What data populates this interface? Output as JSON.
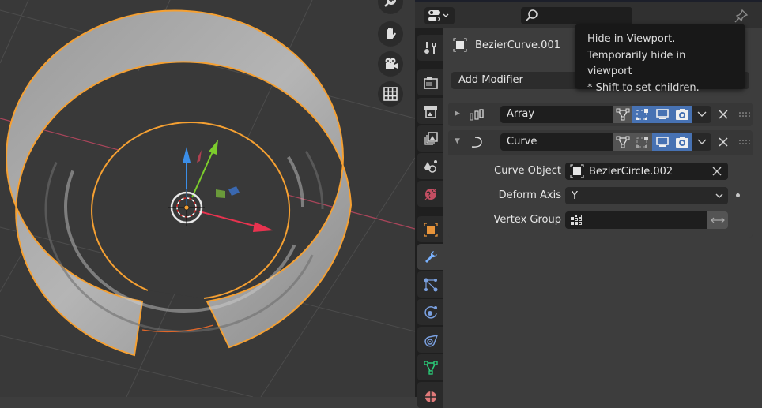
{
  "viewport": {
    "nav_buttons": [
      {
        "name": "zoom-icon"
      },
      {
        "name": "hand-pan-icon"
      },
      {
        "name": "camera-view-icon"
      },
      {
        "name": "grid-ortho-icon"
      }
    ],
    "colors": {
      "background": "#393939",
      "grid": "#4a4a4a",
      "x_axis": "#b8455a",
      "selection_outline": "#f5a032",
      "gizmo_x": "#e8334f",
      "gizmo_y": "#7ccd2c",
      "gizmo_z": "#3b8ee8"
    }
  },
  "properties": {
    "header": {
      "editor_type_icon": "properties-editor-icon",
      "search_placeholder": "",
      "pin_icon": "pin-icon"
    },
    "tabs": [
      {
        "name": "tool",
        "icon": "tool-icon"
      },
      {
        "name": "render",
        "icon": "render-icon"
      },
      {
        "name": "output",
        "icon": "output-icon"
      },
      {
        "name": "view-layer",
        "icon": "view-layer-icon"
      },
      {
        "name": "scene",
        "icon": "scene-icon"
      },
      {
        "name": "world",
        "icon": "world-icon"
      },
      {
        "name": "object",
        "icon": "object-icon"
      },
      {
        "name": "modifiers",
        "icon": "wrench-icon",
        "active": true
      },
      {
        "name": "particles",
        "icon": "particles-icon"
      },
      {
        "name": "physics",
        "icon": "physics-icon"
      },
      {
        "name": "constraints",
        "icon": "constraints-icon"
      },
      {
        "name": "data",
        "icon": "mesh-data-icon"
      },
      {
        "name": "material",
        "icon": "material-icon"
      }
    ],
    "object_name": "BezierCurve.001",
    "add_modifier_label": "Add Modifier",
    "modifiers": [
      {
        "name": "Array",
        "expanded": false,
        "edit_mode": false,
        "on_cage": true,
        "viewport": true,
        "render": true
      },
      {
        "name": "Curve",
        "expanded": true,
        "edit_mode": false,
        "on_cage": false,
        "viewport": true,
        "render": true,
        "fields": {
          "curve_object_label": "Curve Object",
          "curve_object_value": "BezierCircle.002",
          "deform_axis_label": "Deform Axis",
          "deform_axis_value": "Y",
          "vertex_group_label": "Vertex Group",
          "vertex_group_value": ""
        }
      }
    ]
  },
  "tooltip": {
    "title": "Hide in Viewport.",
    "description": "Temporarily hide in viewport",
    "hint": "* Shift to set children."
  }
}
